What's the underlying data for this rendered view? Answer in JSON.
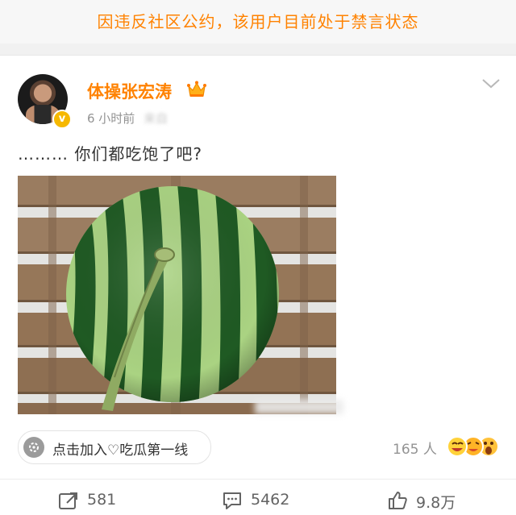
{
  "banner": {
    "text": "因违反社区公约，该用户目前处于禁言状态"
  },
  "post": {
    "username": "体操张宏涛",
    "time": "6 小时前",
    "source_prefix": "来自",
    "text": "……… 你们都吃饱了吧?"
  },
  "topic": {
    "label": "点击加入♡吃瓜第一线",
    "count": "165 人"
  },
  "actions": {
    "repost": "581",
    "comment": "5462",
    "like": "9.8万"
  },
  "colors": {
    "accent": "#ff8200",
    "muted": "#939393"
  },
  "icons": [
    "crown-icon",
    "chevron-down-icon",
    "verified-icon",
    "repost-icon",
    "comment-icon",
    "like-icon",
    "topic-icon"
  ]
}
